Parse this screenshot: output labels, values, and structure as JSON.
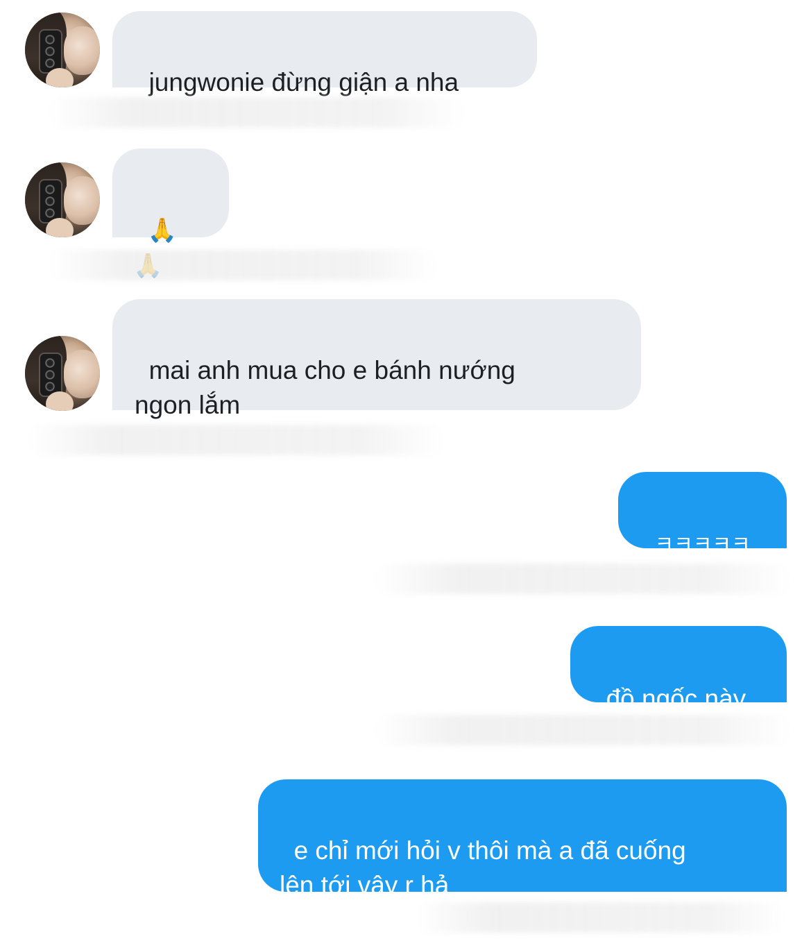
{
  "messages": [
    {
      "from": "other",
      "text": "jungwonie đừng giận a nha"
    },
    {
      "from": "other",
      "text": "🙏🙏"
    },
    {
      "from": "other",
      "text": "mai anh mua cho e bánh nướng\nngon lắm"
    },
    {
      "from": "me",
      "text": "ㅋㅋㅋㅋㅋ"
    },
    {
      "from": "me",
      "text": "đồ ngốc này"
    },
    {
      "from": "me",
      "text": "e chỉ mới hỏi v thôi mà a đã cuống\nlên tới vậy r hả"
    }
  ],
  "colors": {
    "incoming_bubble": "#e8ecf1",
    "outgoing_bubble": "#1d9bf0",
    "outgoing_text": "#ffffff",
    "incoming_text": "#1c1f24"
  }
}
